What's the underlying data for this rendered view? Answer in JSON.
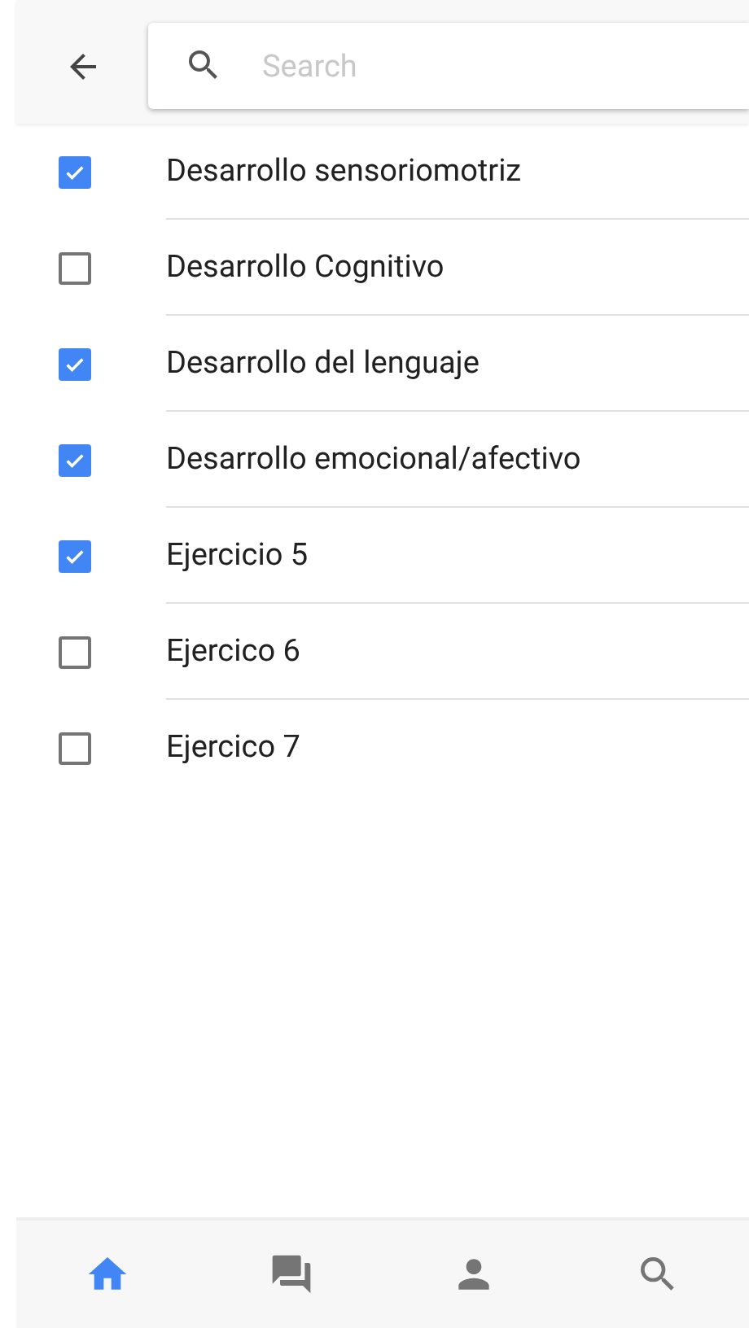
{
  "search": {
    "placeholder": "Search"
  },
  "items": [
    {
      "label": "Desarrollo sensoriomotriz",
      "checked": true
    },
    {
      "label": "Desarrollo Cognitivo",
      "checked": false
    },
    {
      "label": "Desarrollo del lenguaje",
      "checked": true
    },
    {
      "label": "Desarrollo emocional/afectivo",
      "checked": true
    },
    {
      "label": "Ejercicio 5",
      "checked": true
    },
    {
      "label": "Ejercico 6",
      "checked": false
    },
    {
      "label": "Ejercico 7",
      "checked": false
    }
  ],
  "bottom_nav": [
    {
      "kind": "home",
      "selected": true
    },
    {
      "kind": "chat",
      "selected": false
    },
    {
      "kind": "person",
      "selected": false
    },
    {
      "kind": "search",
      "selected": false
    }
  ]
}
